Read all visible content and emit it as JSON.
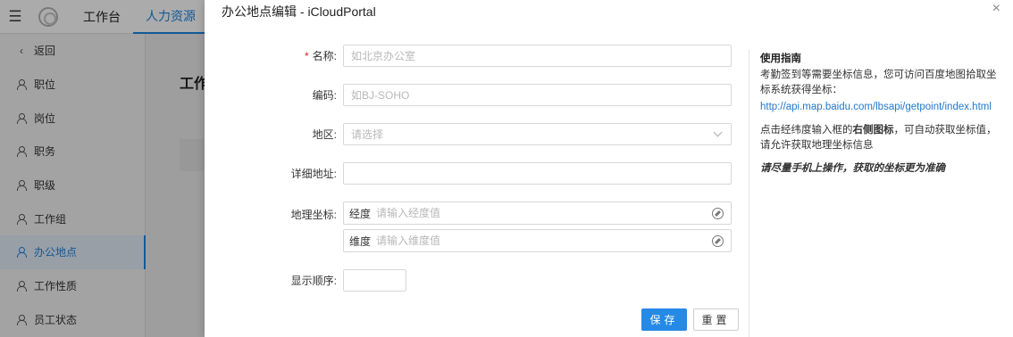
{
  "topbar": {
    "tabs": [
      {
        "label": "工作台"
      },
      {
        "label": "人力资源"
      }
    ]
  },
  "sidebar": {
    "back_label": "返回",
    "items": [
      {
        "label": "职位"
      },
      {
        "label": "岗位"
      },
      {
        "label": "职务"
      },
      {
        "label": "职级"
      },
      {
        "label": "工作组"
      },
      {
        "label": "办公地点"
      },
      {
        "label": "工作性质"
      },
      {
        "label": "员工状态"
      }
    ]
  },
  "main": {
    "title_partial": "工作"
  },
  "modal": {
    "title": "办公地点编辑 - iCloudPortal",
    "close_glyph": "×",
    "form": {
      "name": {
        "label": "名称:",
        "required_mark": "*",
        "placeholder": "如北京办公室",
        "value": ""
      },
      "code": {
        "label": "编码:",
        "placeholder": "如BJ-SOHO",
        "value": ""
      },
      "region": {
        "label": "地区:",
        "placeholder": "请选择"
      },
      "address": {
        "label": "详细地址:",
        "value": ""
      },
      "geo": {
        "label": "地理坐标:",
        "longitude": {
          "prefix": "经度",
          "placeholder": "请输入经度值"
        },
        "latitude": {
          "prefix": "维度",
          "placeholder": "请输入维度值"
        }
      },
      "order": {
        "label": "显示顺序:",
        "value": ""
      }
    },
    "buttons": {
      "save": "保存",
      "reset": "重置"
    },
    "guide": {
      "title": "使用指南",
      "p1": "考勤签到等需要坐标信息，您可访问百度地图拾取坐标系统获得坐标：",
      "link": "http://api.map.baidu.com/lbsapi/getpoint/index.html",
      "p2_before": "点击经纬度输入框的",
      "p2_bold": "右侧图标",
      "p2_after": "，可自动获取坐标值，请允许获取地理坐标信息",
      "note": "请尽量手机上操作，获取的坐标更为准确"
    }
  },
  "colors": {
    "accent": "#2589e6",
    "required": "#e02020",
    "link": "#2178cc"
  }
}
